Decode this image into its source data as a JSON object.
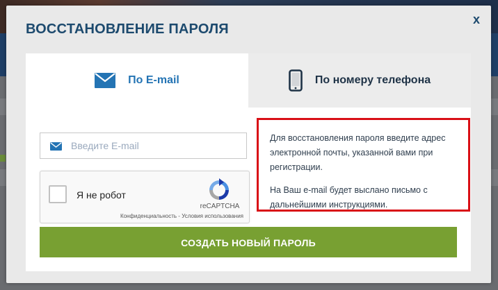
{
  "modal": {
    "title": "ВОССТАНОВЛЕНИЕ ПАРОЛЯ",
    "close_label": "x"
  },
  "tabs": [
    {
      "label": "По E-mail",
      "icon": "envelope-icon",
      "active": true
    },
    {
      "label": "По номеру телефона",
      "icon": "smartphone-icon",
      "active": false
    }
  ],
  "form": {
    "email_placeholder": "Введите E-mail",
    "email_value": ""
  },
  "recaptcha": {
    "label": "Я не робот",
    "brand": "reCAPTCHA",
    "links": "Конфиденциальность - Условия использования"
  },
  "info": {
    "paragraph1": "Для восстановления пароля введите адрес электронной почты, указанной вами при регистрации.",
    "paragraph2": "На Ваш e-mail будет выслано письмо с дальнейшими инструкциями."
  },
  "submit_label": "СОЗДАТЬ НОВЫЙ ПАРОЛЬ",
  "colors": {
    "title": "#1d4a6e",
    "active_tab": "#2474b4",
    "submit": "#78a032",
    "highlight_border": "#d90f16"
  }
}
